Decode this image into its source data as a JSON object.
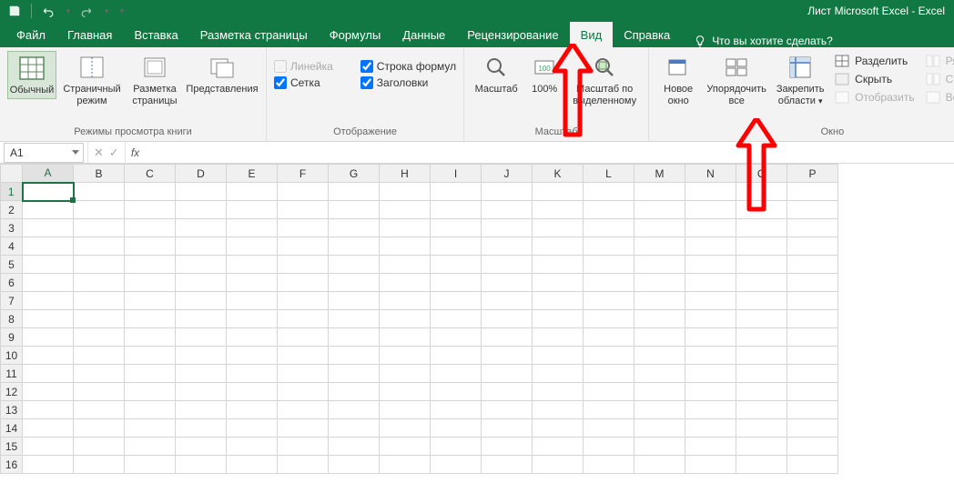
{
  "title": {
    "doc": "Лист Microsoft Excel",
    "app": "Excel",
    "sep": "  -  "
  },
  "qat": {
    "save": "save-icon",
    "undo": "undo-icon",
    "redo": "redo-icon"
  },
  "menu": {
    "file": "Файл",
    "home": "Главная",
    "insert": "Вставка",
    "pagelayout": "Разметка страницы",
    "formulas": "Формулы",
    "data": "Данные",
    "review": "Рецензирование",
    "view": "Вид",
    "help": "Справка",
    "tellme": "Что вы хотите сделать?"
  },
  "ribbon": {
    "views": {
      "normal": "Обычный",
      "pagebreak": "Страничный режим",
      "pagelayout": "Разметка страницы",
      "custom": "Представления",
      "group": "Режимы просмотра книги"
    },
    "show": {
      "ruler": "Линейка",
      "gridlines": "Сетка",
      "formulabar": "Строка формул",
      "headings": "Заголовки",
      "group": "Отображение"
    },
    "zoom": {
      "zoom": "Масштаб",
      "hundred": "100%",
      "toselection_l1": "Масштаб по",
      "toselection_l2": "выделенному",
      "group": "Масштаб"
    },
    "window": {
      "newwin_l1": "Новое",
      "newwin_l2": "окно",
      "arrange_l1": "Упорядочить",
      "arrange_l2": "все",
      "freeze_l1": "Закрепить",
      "freeze_l2": "области",
      "split": "Разделить",
      "hide": "Скрыть",
      "unhide": "Отобразить",
      "sidebyside": "Рядом",
      "syncscroll": "Синхронна",
      "resetpos": "Восстанови",
      "group": "Окно"
    }
  },
  "namebox": {
    "value": "A1"
  },
  "fx": "fx",
  "columns": [
    "A",
    "B",
    "C",
    "D",
    "E",
    "F",
    "G",
    "H",
    "I",
    "J",
    "K",
    "L",
    "M",
    "N",
    "O",
    "P"
  ],
  "rows": [
    "1",
    "2",
    "3",
    "4",
    "5",
    "6",
    "7",
    "8",
    "9",
    "10",
    "11",
    "12",
    "13",
    "14",
    "15",
    "16"
  ],
  "selected_cell": "A1"
}
